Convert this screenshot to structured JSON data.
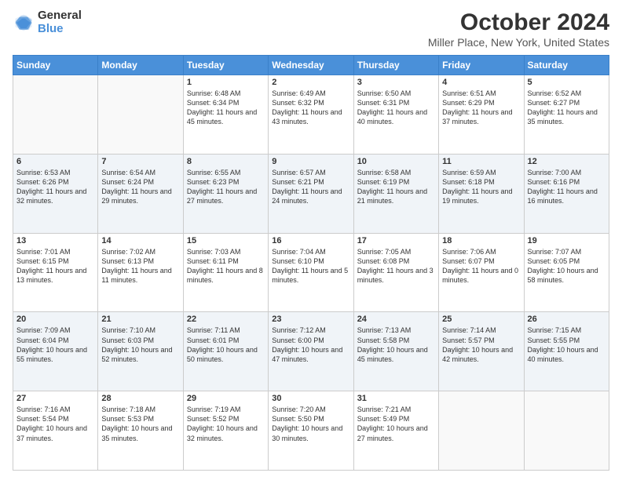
{
  "header": {
    "logo_general": "General",
    "logo_blue": "Blue",
    "month_year": "October 2024",
    "location": "Miller Place, New York, United States"
  },
  "days_of_week": [
    "Sunday",
    "Monday",
    "Tuesday",
    "Wednesday",
    "Thursday",
    "Friday",
    "Saturday"
  ],
  "weeks": [
    [
      {
        "day": "",
        "info": ""
      },
      {
        "day": "",
        "info": ""
      },
      {
        "day": "1",
        "info": "Sunrise: 6:48 AM\nSunset: 6:34 PM\nDaylight: 11 hours and 45 minutes."
      },
      {
        "day": "2",
        "info": "Sunrise: 6:49 AM\nSunset: 6:32 PM\nDaylight: 11 hours and 43 minutes."
      },
      {
        "day": "3",
        "info": "Sunrise: 6:50 AM\nSunset: 6:31 PM\nDaylight: 11 hours and 40 minutes."
      },
      {
        "day": "4",
        "info": "Sunrise: 6:51 AM\nSunset: 6:29 PM\nDaylight: 11 hours and 37 minutes."
      },
      {
        "day": "5",
        "info": "Sunrise: 6:52 AM\nSunset: 6:27 PM\nDaylight: 11 hours and 35 minutes."
      }
    ],
    [
      {
        "day": "6",
        "info": "Sunrise: 6:53 AM\nSunset: 6:26 PM\nDaylight: 11 hours and 32 minutes."
      },
      {
        "day": "7",
        "info": "Sunrise: 6:54 AM\nSunset: 6:24 PM\nDaylight: 11 hours and 29 minutes."
      },
      {
        "day": "8",
        "info": "Sunrise: 6:55 AM\nSunset: 6:23 PM\nDaylight: 11 hours and 27 minutes."
      },
      {
        "day": "9",
        "info": "Sunrise: 6:57 AM\nSunset: 6:21 PM\nDaylight: 11 hours and 24 minutes."
      },
      {
        "day": "10",
        "info": "Sunrise: 6:58 AM\nSunset: 6:19 PM\nDaylight: 11 hours and 21 minutes."
      },
      {
        "day": "11",
        "info": "Sunrise: 6:59 AM\nSunset: 6:18 PM\nDaylight: 11 hours and 19 minutes."
      },
      {
        "day": "12",
        "info": "Sunrise: 7:00 AM\nSunset: 6:16 PM\nDaylight: 11 hours and 16 minutes."
      }
    ],
    [
      {
        "day": "13",
        "info": "Sunrise: 7:01 AM\nSunset: 6:15 PM\nDaylight: 11 hours and 13 minutes."
      },
      {
        "day": "14",
        "info": "Sunrise: 7:02 AM\nSunset: 6:13 PM\nDaylight: 11 hours and 11 minutes."
      },
      {
        "day": "15",
        "info": "Sunrise: 7:03 AM\nSunset: 6:11 PM\nDaylight: 11 hours and 8 minutes."
      },
      {
        "day": "16",
        "info": "Sunrise: 7:04 AM\nSunset: 6:10 PM\nDaylight: 11 hours and 5 minutes."
      },
      {
        "day": "17",
        "info": "Sunrise: 7:05 AM\nSunset: 6:08 PM\nDaylight: 11 hours and 3 minutes."
      },
      {
        "day": "18",
        "info": "Sunrise: 7:06 AM\nSunset: 6:07 PM\nDaylight: 11 hours and 0 minutes."
      },
      {
        "day": "19",
        "info": "Sunrise: 7:07 AM\nSunset: 6:05 PM\nDaylight: 10 hours and 58 minutes."
      }
    ],
    [
      {
        "day": "20",
        "info": "Sunrise: 7:09 AM\nSunset: 6:04 PM\nDaylight: 10 hours and 55 minutes."
      },
      {
        "day": "21",
        "info": "Sunrise: 7:10 AM\nSunset: 6:03 PM\nDaylight: 10 hours and 52 minutes."
      },
      {
        "day": "22",
        "info": "Sunrise: 7:11 AM\nSunset: 6:01 PM\nDaylight: 10 hours and 50 minutes."
      },
      {
        "day": "23",
        "info": "Sunrise: 7:12 AM\nSunset: 6:00 PM\nDaylight: 10 hours and 47 minutes."
      },
      {
        "day": "24",
        "info": "Sunrise: 7:13 AM\nSunset: 5:58 PM\nDaylight: 10 hours and 45 minutes."
      },
      {
        "day": "25",
        "info": "Sunrise: 7:14 AM\nSunset: 5:57 PM\nDaylight: 10 hours and 42 minutes."
      },
      {
        "day": "26",
        "info": "Sunrise: 7:15 AM\nSunset: 5:55 PM\nDaylight: 10 hours and 40 minutes."
      }
    ],
    [
      {
        "day": "27",
        "info": "Sunrise: 7:16 AM\nSunset: 5:54 PM\nDaylight: 10 hours and 37 minutes."
      },
      {
        "day": "28",
        "info": "Sunrise: 7:18 AM\nSunset: 5:53 PM\nDaylight: 10 hours and 35 minutes."
      },
      {
        "day": "29",
        "info": "Sunrise: 7:19 AM\nSunset: 5:52 PM\nDaylight: 10 hours and 32 minutes."
      },
      {
        "day": "30",
        "info": "Sunrise: 7:20 AM\nSunset: 5:50 PM\nDaylight: 10 hours and 30 minutes."
      },
      {
        "day": "31",
        "info": "Sunrise: 7:21 AM\nSunset: 5:49 PM\nDaylight: 10 hours and 27 minutes."
      },
      {
        "day": "",
        "info": ""
      },
      {
        "day": "",
        "info": ""
      }
    ]
  ]
}
